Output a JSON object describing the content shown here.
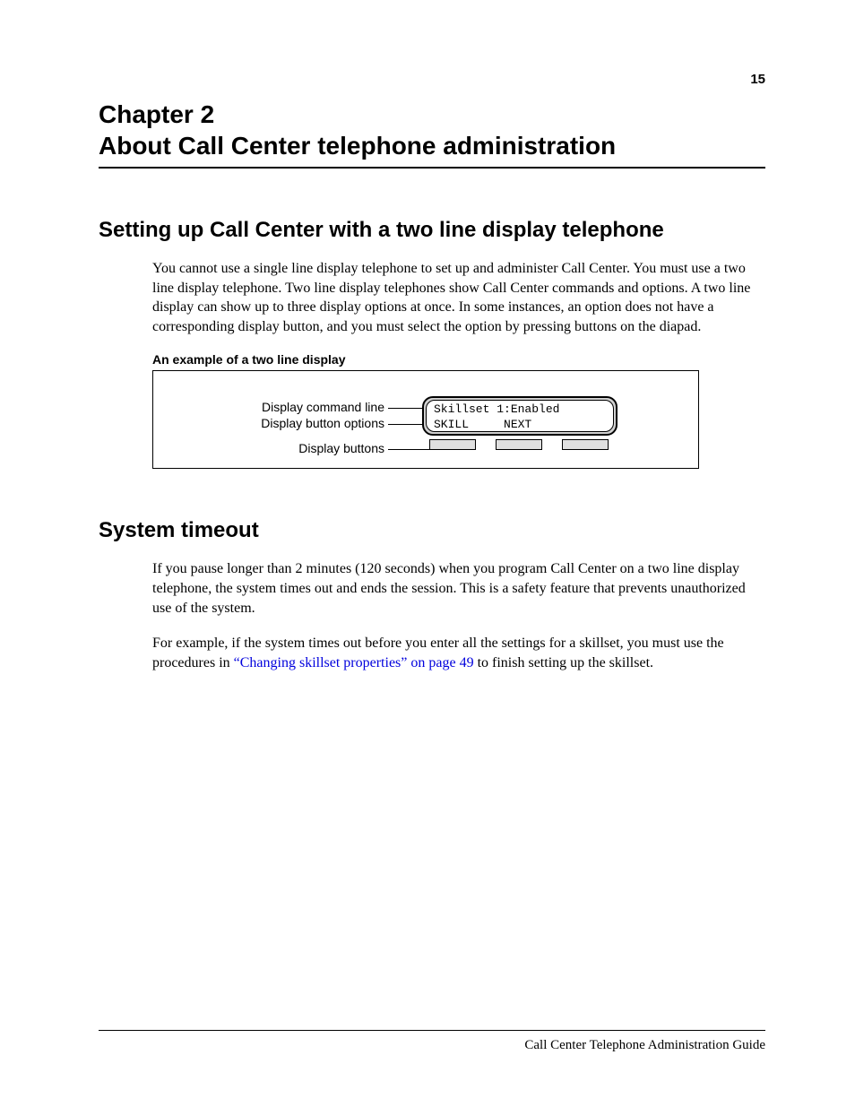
{
  "page_number": "15",
  "chapter_line1": "Chapter 2",
  "chapter_line2": "About Call Center telephone administration",
  "section1": {
    "heading": "Setting up Call Center with a two line display telephone",
    "para1": "You cannot use a single line display telephone to set up and administer Call Center. You must use a two line display telephone. Two line display telephones show Call Center commands and options. A two line display can show up to three display options at once. In some instances, an option does not have a corresponding display button, and you must select the option by pressing buttons on the diapad.",
    "figure_caption": "An example of a two line display",
    "labels": {
      "l1": "Display command line",
      "l2": "Display button options",
      "l3": "Display buttons"
    },
    "display_line1": "Skillset 1:Enabled",
    "display_line2": "SKILL     NEXT"
  },
  "section2": {
    "heading": "System timeout",
    "para1": "If you pause longer than 2 minutes (120 seconds) when you program Call Center on a two line display telephone, the system times out and ends the session. This is a safety feature that prevents unauthorized use of the system.",
    "para2_pre": "For example, if the system times out before you enter all the settings for a skillset, you must use the procedures in ",
    "para2_link": "“Changing skillset properties” on page 49",
    "para2_post": " to finish setting up the skillset."
  },
  "footer": "Call Center Telephone Administration Guide"
}
